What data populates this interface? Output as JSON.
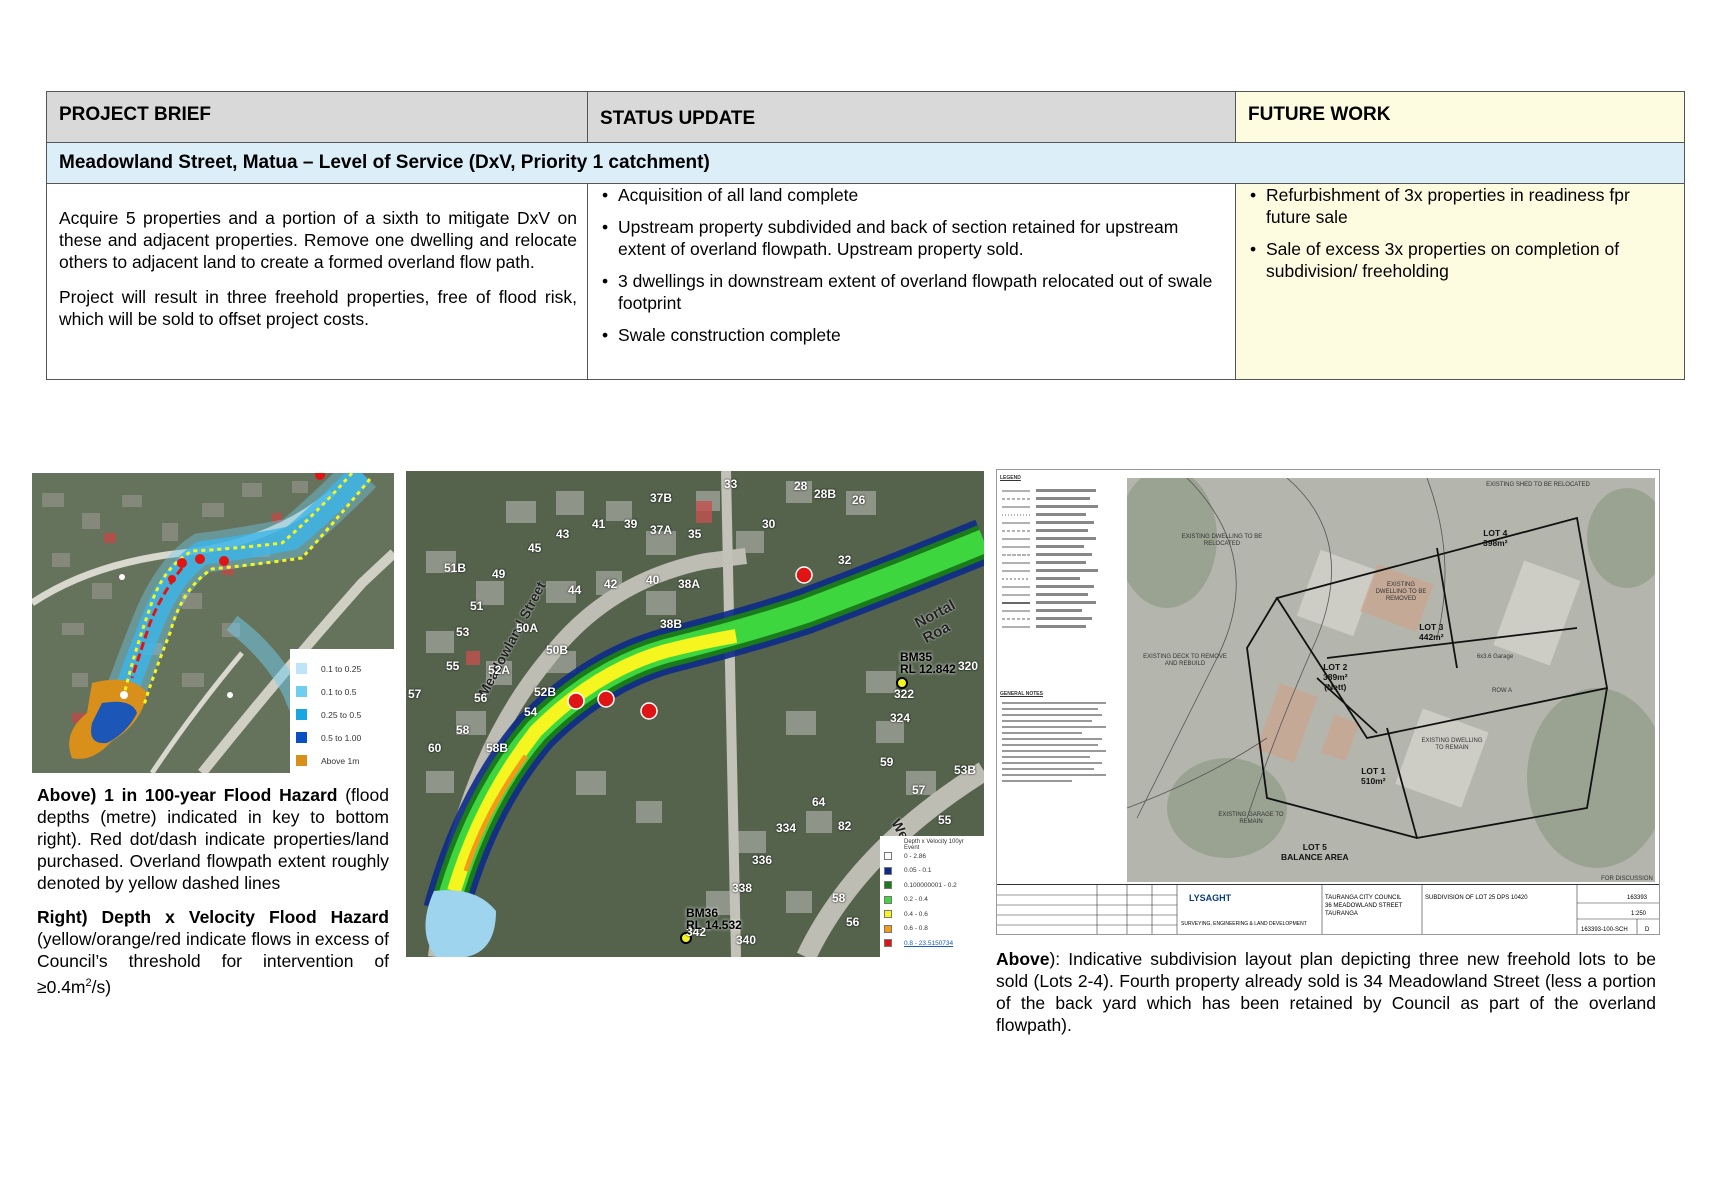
{
  "table": {
    "headers": {
      "brief": "PROJECT BRIEF",
      "status": "STATUS UPDATE",
      "future": "FUTURE WORK"
    },
    "project_title": "Meadowland Street, Matua  – Level of Service (DxV, Priority 1 catchment)",
    "brief_paragraphs": [
      "Acquire 5 properties and a portion of a sixth to mitigate DxV on these and adjacent properties.  Remove one dwelling and relocate others to adjacent land to create a formed overland flow path.",
      "Project will result in three freehold properties, free of flood risk, which will be sold to offset project costs."
    ],
    "status_items": [
      "Acquisition of all land complete",
      "Upstream property subdivided and back of section retained for upstream extent of overland flowpath.  Upstream property sold.",
      "3 dwellings in downstream extent of overland flowpath relocated out of swale footprint",
      "Swale construction complete"
    ],
    "future_items": [
      "Refurbishment of 3x properties in readiness fpr future sale",
      "Sale of excess 3x properties on completion of subdivision/ freeholding"
    ]
  },
  "map_left": {
    "legend": [
      {
        "label": "0.1 to 0.25",
        "color": "#bfe4f7"
      },
      {
        "label": "0.1 to 0.5",
        "color": "#6fcdf0"
      },
      {
        "label": "0.25 to 0.5",
        "color": "#1aa5e3"
      },
      {
        "label": "0.5 to 1.00",
        "color": "#0b4fc4"
      },
      {
        "label": "Above 1m",
        "color": "#d9901a"
      }
    ]
  },
  "map_mid": {
    "street_labels": [
      "Meadowland Street",
      "Nortal Roa",
      "We"
    ],
    "lot_numbers": [
      "33",
      "28",
      "28B",
      "26",
      "37B",
      "30",
      "41",
      "39",
      "37A",
      "35",
      "32",
      "45",
      "43",
      "51B",
      "49",
      "44",
      "42",
      "40",
      "38A",
      "51",
      "53",
      "50A",
      "38B",
      "50B",
      "55",
      "52A",
      "52B",
      "54",
      "56",
      "57",
      "58",
      "58B",
      "60",
      "320",
      "322",
      "324",
      "59",
      "53B",
      "57",
      "55",
      "64",
      "82",
      "334",
      "336",
      "338",
      "58",
      "56",
      "340",
      "342"
    ],
    "benchmarks": [
      {
        "name": "BM35",
        "rl": "RL 12.842"
      },
      {
        "name": "BM36",
        "rl": "RL 14.532"
      }
    ],
    "legend_title": "Depth x Velocity 100yr Event",
    "legend": [
      {
        "label": "0 - 2.86",
        "color": "#ffffff"
      },
      {
        "label": "0.05 - 0.1",
        "color": "#0d2a8a"
      },
      {
        "label": "0.100000001 - 0.2",
        "color": "#1b7a1b"
      },
      {
        "label": "0.2 - 0.4",
        "color": "#3ed63e"
      },
      {
        "label": "0.4 - 0.6",
        "color": "#f5f51f"
      },
      {
        "label": "0.6 - 0.8",
        "color": "#f29b1a"
      },
      {
        "label": "0.8 - 23.5150734",
        "color": "#e01414"
      }
    ]
  },
  "captions": {
    "left_above_bold": "Above) 1 in 100-year Flood Hazard",
    "left_above_text": " (flood depths (metre) indicated in key to bottom right).  Red dot/dash indicate properties/land purchased.  Overland flowpath extent roughly denoted by yellow dashed lines",
    "left_right_bold": "Right) Depth x Velocity Flood Hazard",
    "left_right_text": " (yellow/orange/red indicate flows in excess of Council’s threshold for intervention of ≥0.4m",
    "left_right_sup": "2",
    "left_right_tail": "/s)",
    "right_bold": "Above",
    "right_text": "): Indicative subdivision layout plan depicting three new freehold lots to be sold (Lots 2-4). Fourth property already sold is 34 Meadowland Street (less a portion of the back yard which has been retained by Council as part of the overland flowpath)."
  },
  "plan": {
    "legend_title": "LEGEND",
    "general_notes_title": "GENERAL NOTES",
    "notes": {
      "existing_shed": "EXISTING SHED TO BE RELOCATED",
      "existing_dwelling_relocated": "EXISTING DWELLING TO BE RELOCATED",
      "existing_dwelling_removed": "EXISTING DWELLING TO BE REMOVED",
      "existing_deck": "EXISTING DECK TO REMOVE AND REBUILD",
      "existing_dwelling_remain": "EXISTING DWELLING TO REMAIN",
      "existing_garage": "EXISTING GARAGE TO REMAIN",
      "row_a": "ROW A",
      "garage": "6x3.6 Garage",
      "for_discussion": "FOR DISCUSSION"
    },
    "lots": [
      {
        "name": "LOT 4",
        "area": "398m²"
      },
      {
        "name": "LOT 3",
        "area": "442m²"
      },
      {
        "name": "LOT 2",
        "area": "389m²",
        "note": "(Nett)"
      },
      {
        "name": "LOT 1",
        "area": "510m²"
      },
      {
        "name": "LOT 5",
        "area": "BALANCE AREA"
      }
    ],
    "titleblock": {
      "company": "LYSAGHT",
      "company_tag": "SURVEYING, ENGINEERING & LAND DEVELOPMENT",
      "client": "TAURANGA CITY COUNCIL",
      "address": "36 MEADOWLAND STREET",
      "city": "TAURANGA",
      "drawing_title": "SUBDIVISION OF LOT 25 DPS 10420",
      "project_no": "163393",
      "scale": "1:250",
      "drawing_no": "163393-100-SCH",
      "rev": "D"
    }
  }
}
